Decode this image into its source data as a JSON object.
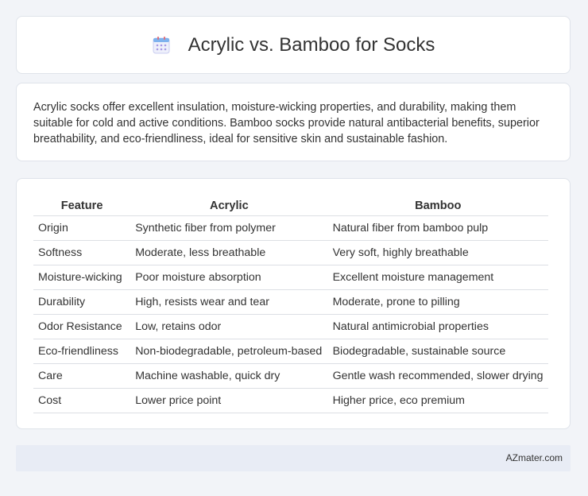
{
  "header": {
    "title": "Acrylic vs. Bamboo for Socks",
    "icon": "calendar-icon"
  },
  "intro": {
    "text": "Acrylic socks offer excellent insulation, moisture-wicking properties, and durability, making them suitable for cold and active conditions. Bamboo socks provide natural antibacterial benefits, superior breathability, and eco-friendliness, ideal for sensitive skin and sustainable fashion."
  },
  "table": {
    "headers": [
      "Feature",
      "Acrylic",
      "Bamboo"
    ],
    "rows": [
      [
        "Origin",
        "Synthetic fiber from polymer",
        "Natural fiber from bamboo pulp"
      ],
      [
        "Softness",
        "Moderate, less breathable",
        "Very soft, highly breathable"
      ],
      [
        "Moisture-wicking",
        "Poor moisture absorption",
        "Excellent moisture management"
      ],
      [
        "Durability",
        "High, resists wear and tear",
        "Moderate, prone to pilling"
      ],
      [
        "Odor Resistance",
        "Low, retains odor",
        "Natural antimicrobial properties"
      ],
      [
        "Eco-friendliness",
        "Non-biodegradable, petroleum-based",
        "Biodegradable, sustainable source"
      ],
      [
        "Care",
        "Machine washable, quick dry",
        "Gentle wash recommended, slower drying"
      ],
      [
        "Cost",
        "Lower price point",
        "Higher price, eco premium"
      ]
    ]
  },
  "footer": {
    "site": "AZmater.com"
  },
  "colors": {
    "page_bg": "#f2f4f8",
    "card_bg": "#ffffff",
    "footer_bg": "#e8ecf5",
    "icon_accent": "#8a7fd6"
  }
}
